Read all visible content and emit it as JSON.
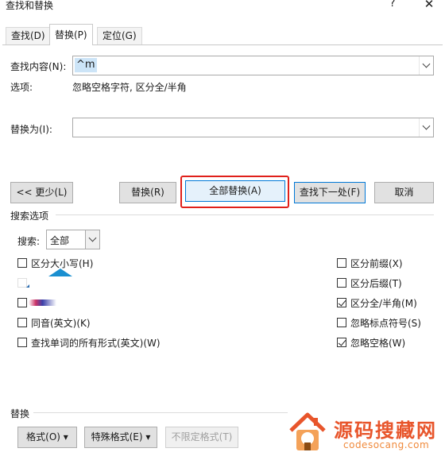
{
  "window": {
    "title": "查找和替换",
    "help": "?",
    "close": "✕"
  },
  "tabs": [
    {
      "label": "查找(D)"
    },
    {
      "label": "替换(P)"
    },
    {
      "label": "定位(G)"
    }
  ],
  "find": {
    "label": "查找内容(N):",
    "value": "^m"
  },
  "options_line": {
    "label": "选项:",
    "value": "忽略空格字符, 区分全/半角"
  },
  "replace": {
    "label": "替换为(I):",
    "value": ""
  },
  "buttons": {
    "less": "<< 更少(L)",
    "replace": "替换(R)",
    "replace_all": "全部替换(A)",
    "find_next": "查找下一处(F)",
    "cancel": "取消"
  },
  "search_options": {
    "heading": "搜索选项",
    "search_label": "搜索:",
    "search_value": "全部"
  },
  "left_options": [
    {
      "label": "区分大小写(H)",
      "checked": false
    },
    {
      "label": "",
      "checked": false
    },
    {
      "label": "",
      "checked": false
    },
    {
      "label": "同音(英文)(K)",
      "checked": false
    },
    {
      "label": "查找单词的所有形式(英文)(W)",
      "checked": false
    }
  ],
  "right_options": [
    {
      "label": "区分前缀(X)",
      "checked": false
    },
    {
      "label": "区分后缀(T)",
      "checked": false
    },
    {
      "label": "区分全/半角(M)",
      "checked": true
    },
    {
      "label": "忽略标点符号(S)",
      "checked": false
    },
    {
      "label": "忽略空格(W)",
      "checked": true
    }
  ],
  "replace_section": {
    "heading": "替换",
    "format": "格式(O) ▾",
    "special": "特殊格式(E) ▾",
    "no_format": "不限定格式(T)"
  },
  "watermark": {
    "brand": "源码搜藏网",
    "url": "codesocang.com"
  }
}
